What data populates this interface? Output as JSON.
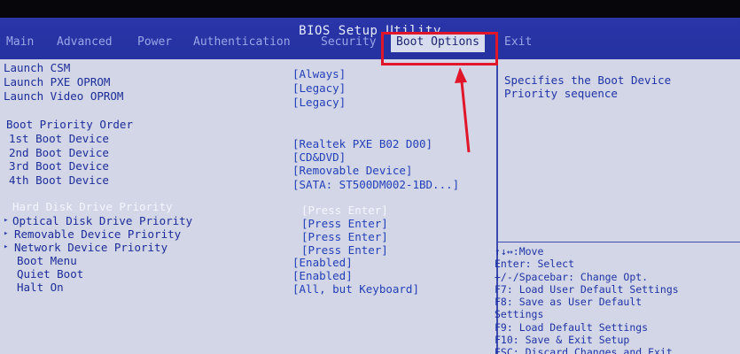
{
  "title": "BIOS Setup Utility",
  "tabs": [
    "Main",
    "Advanced",
    "Power",
    "Authentication",
    "Security",
    "Boot Options",
    "Exit"
  ],
  "settings": [
    {
      "label": "Launch CSM",
      "value": "[Always]"
    },
    {
      "label": "Launch PXE OPROM",
      "value": "[Legacy]"
    },
    {
      "label": "Launch Video OPROM",
      "value": "[Legacy]"
    }
  ],
  "boot_priority": {
    "heading": "Boot Priority Order",
    "devices": [
      {
        "label": "1st Boot Device",
        "value": "[Realtek PXE B02 D00]"
      },
      {
        "label": "2nd Boot Device",
        "value": "[CD&DVD]"
      },
      {
        "label": "3rd Boot Device",
        "value": "[Removable Device]"
      },
      {
        "label": "4th Boot Device",
        "value": "[SATA: ST500DM002-1BD...]"
      }
    ]
  },
  "submenus": [
    {
      "label": "Hard Disk Drive Priority",
      "value": "[Press Enter]"
    },
    {
      "label": "Optical Disk Drive Priority",
      "value": "[Press Enter]"
    },
    {
      "label": "Removable Device Priority",
      "value": "[Press Enter]"
    },
    {
      "label": "Network Device Priority",
      "value": "[Press Enter]"
    }
  ],
  "more_settings": [
    {
      "label": "Boot Menu",
      "value": "[Enabled]"
    },
    {
      "label": "Quiet Boot",
      "value": "[Enabled]"
    },
    {
      "label": "Halt On",
      "value": "[All, but Keyboard]"
    }
  ],
  "help_text": [
    "Specifies the Boot Device",
    "Priority sequence"
  ],
  "key_hints": [
    "↑↓↔:Move",
    "Enter: Select",
    "+/-/Spacebar: Change Opt.",
    "F7: Load User Default Settings",
    "F8: Save as User Default",
    "Settings",
    "F9: Load Default Settings",
    "F10: Save & Exit Setup",
    "ESC: Discard Changes and Exit"
  ],
  "colors": {
    "accent": "#2532a0",
    "panel": "#d2d6e6",
    "callout": "#e2162a"
  }
}
